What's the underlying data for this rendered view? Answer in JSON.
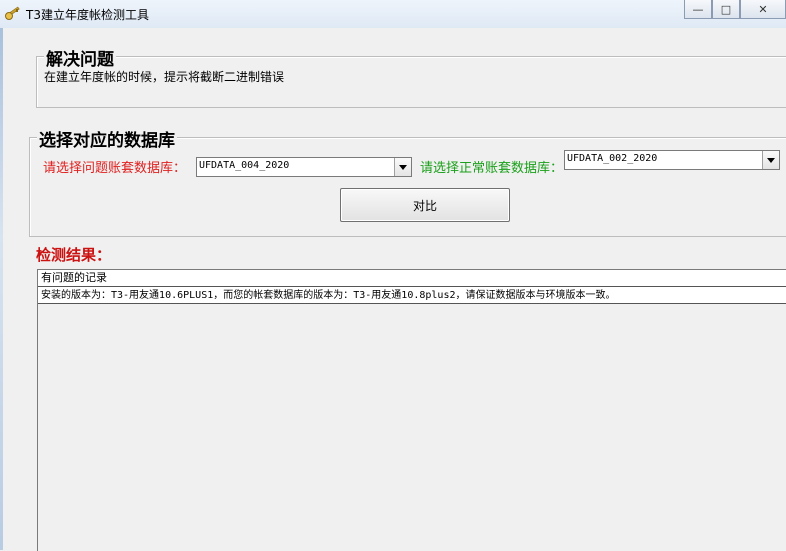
{
  "window": {
    "title": "T3建立年度帐检测工具",
    "minimize_glyph": "—",
    "maximize_glyph": "□",
    "close_glyph": "✕"
  },
  "problem": {
    "title": "解决问题",
    "description": "在建立年度帐的时候，提示将截断二进制错误"
  },
  "database": {
    "title": "选择对应的数据库",
    "problem_label": "请选择问题账套数据库：",
    "problem_value": "UFDATA_004_2020",
    "normal_label": "请选择正常账套数据库：",
    "normal_value": "UFDATA_002_2020",
    "compare_button": "对比"
  },
  "results": {
    "label": "检测结果：",
    "rows": [
      "有问题的记录",
      "安装的版本为：T3-用友通10.6PLUS1，而您的帐套数据库的版本为：T3-用友通10.8plus2，请保证数据版本与环境版本一致。"
    ]
  },
  "colors": {
    "problem_label": "#e02020",
    "normal_label": "#1aa01a",
    "results_label": "#cc1111"
  },
  "icons": {
    "app": "key-icon",
    "dropdown": "chevron-down-icon"
  }
}
